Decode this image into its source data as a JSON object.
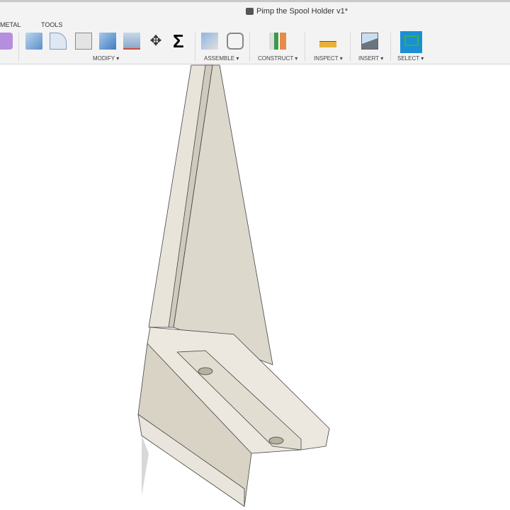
{
  "window": {
    "title": "Pimp the Spool Holder v1*"
  },
  "tabs": [
    {
      "label": "METAL"
    },
    {
      "label": "TOOLS"
    }
  ],
  "groups": {
    "modify": "MODIFY ▾",
    "assemble": "ASSEMBLE ▾",
    "construct": "CONSTRUCT ▾",
    "inspect": "INSPECT ▾",
    "insert": "INSERT ▾",
    "select": "SELECT ▾"
  },
  "colors": {
    "select_active": "#1a8fd6",
    "model_face": "#e6e1d6"
  }
}
